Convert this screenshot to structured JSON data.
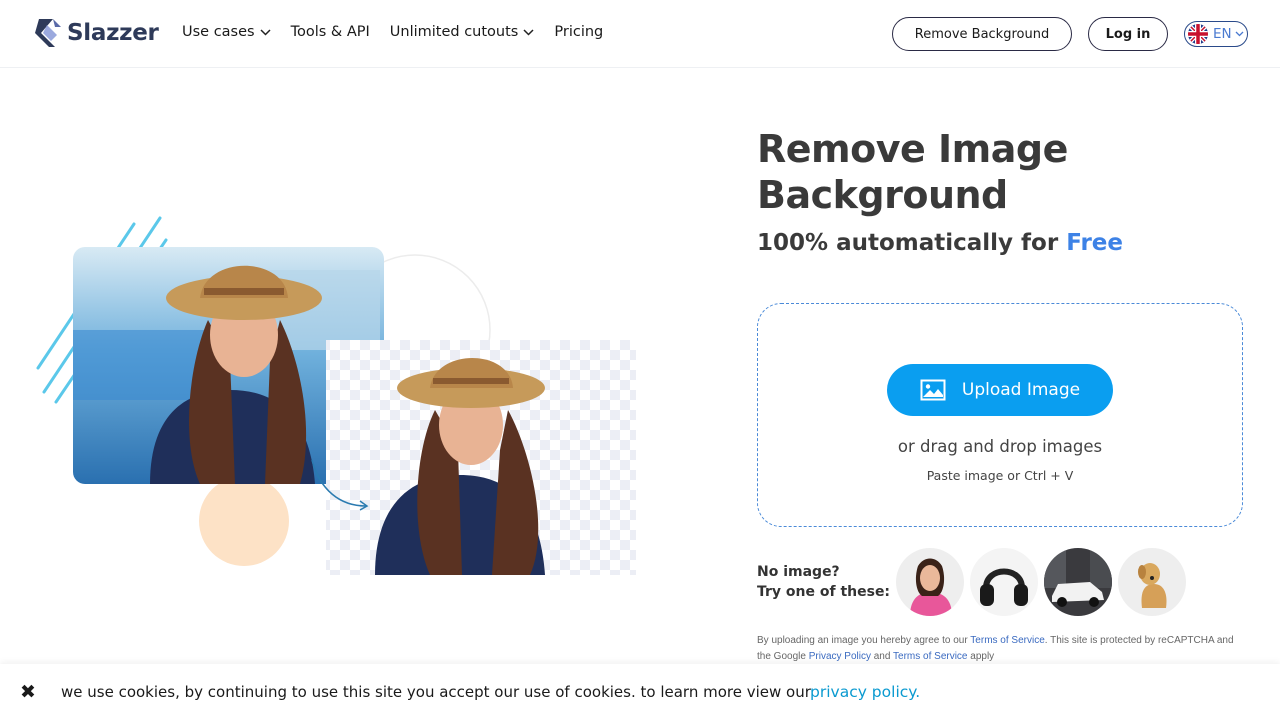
{
  "header": {
    "logo_text": "Slazzer",
    "nav": [
      {
        "label": "Use cases",
        "dropdown": true
      },
      {
        "label": "Tools & API",
        "dropdown": false
      },
      {
        "label": "Unlimited cutouts",
        "dropdown": true
      },
      {
        "label": "Pricing",
        "dropdown": false
      }
    ],
    "remove_bg_label": "Remove Background",
    "login_label": "Log in",
    "language": "EN"
  },
  "hero": {
    "title": "Remove Image Background",
    "subtitle_prefix": "100% automatically for ",
    "subtitle_highlight": "Free"
  },
  "upload": {
    "button_label": "Upload Image",
    "drag_text": "or drag and drop images",
    "paste_text": "Paste image or Ctrl + V"
  },
  "samples": {
    "line1": "No image?",
    "line2": "Try one of these:",
    "items": [
      "woman-photo",
      "headphones-photo",
      "car-photo",
      "dog-photo"
    ]
  },
  "legal": {
    "t1": "By uploading an image you hereby agree to our ",
    "link1": "Terms of Service",
    "t2": ". This site is protected by reCAPTCHA and the Google ",
    "link2": "Privacy Policy",
    "t3": " and ",
    "link3": "Terms of Service",
    "t4": " apply"
  },
  "cookie": {
    "close_icon": "✖",
    "text": "we use cookies, by continuing to use this site you accept our use of cookies. to learn more view our",
    "link": "privacy policy."
  },
  "colors": {
    "brand_dark": "#2e3a59",
    "accent_blue": "#0a9ef0",
    "free_blue": "#3d82e6",
    "link_blue": "#0a9ad0"
  }
}
